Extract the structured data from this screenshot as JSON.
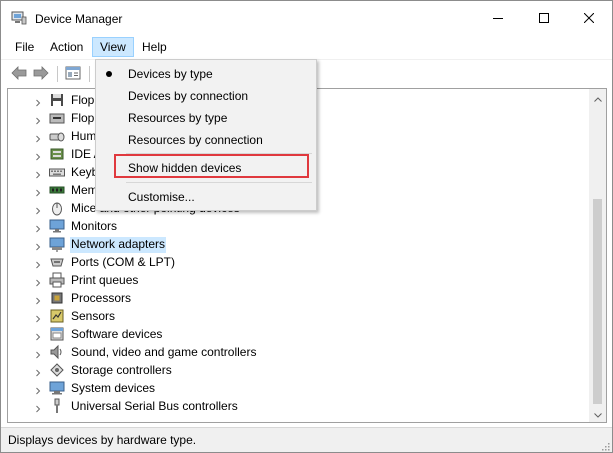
{
  "window": {
    "title": "Device Manager",
    "icon": "device-manager-icon"
  },
  "menubar": {
    "items": [
      {
        "label": "File"
      },
      {
        "label": "Action"
      },
      {
        "label": "View"
      },
      {
        "label": "Help"
      }
    ]
  },
  "view_menu": {
    "items": [
      {
        "label": "Devices by type",
        "checked": true
      },
      {
        "label": "Devices by connection"
      },
      {
        "label": "Resources by type"
      },
      {
        "label": "Resources by connection"
      },
      {
        "label": "Show hidden devices",
        "highlighted": true
      },
      {
        "label": "Customise..."
      }
    ]
  },
  "tree": {
    "nodes": [
      {
        "label": "Floppy disk controllers",
        "icon": "floppy-controller-icon",
        "visible_text": "Flop"
      },
      {
        "label": "Floppy drive controllers",
        "icon": "floppy-drive-icon",
        "visible_text": "Flop"
      },
      {
        "label": "Human Interface Devices",
        "icon": "hid-icon",
        "visible_text": "Hum"
      },
      {
        "label": "IDE ATA/ATAPI controllers",
        "icon": "ide-icon",
        "visible_text": "IDE A"
      },
      {
        "label": "Keyboards",
        "icon": "keyboard-icon",
        "visible_text": "Keyb"
      },
      {
        "label": "Memory technology devices",
        "icon": "memory-icon",
        "visible_text": "Mem"
      },
      {
        "label": "Mice and other pointing devices",
        "icon": "mouse-icon",
        "visible_text": "Mice and other pointing devices"
      },
      {
        "label": "Monitors",
        "icon": "monitor-icon",
        "visible_text": "Monitors"
      },
      {
        "label": "Network adapters",
        "icon": "network-adapter-icon",
        "visible_text": "Network adapters",
        "selected": true
      },
      {
        "label": "Ports (COM & LPT)",
        "icon": "port-icon",
        "visible_text": "Ports (COM & LPT)"
      },
      {
        "label": "Print queues",
        "icon": "printer-icon",
        "visible_text": "Print queues"
      },
      {
        "label": "Processors",
        "icon": "processor-icon",
        "visible_text": "Processors"
      },
      {
        "label": "Sensors",
        "icon": "sensor-icon",
        "visible_text": "Sensors"
      },
      {
        "label": "Software devices",
        "icon": "software-device-icon",
        "visible_text": "Software devices"
      },
      {
        "label": "Sound, video and game controllers",
        "icon": "speaker-icon",
        "visible_text": "Sound, video and game controllers"
      },
      {
        "label": "Storage controllers",
        "icon": "storage-controller-icon",
        "visible_text": "Storage controllers"
      },
      {
        "label": "System devices",
        "icon": "system-device-icon",
        "visible_text": "System devices"
      },
      {
        "label": "Universal Serial Bus controllers",
        "icon": "usb-icon",
        "visible_text": "Universal Serial Bus controllers"
      }
    ]
  },
  "statusbar": {
    "text": "Displays devices by hardware type."
  }
}
